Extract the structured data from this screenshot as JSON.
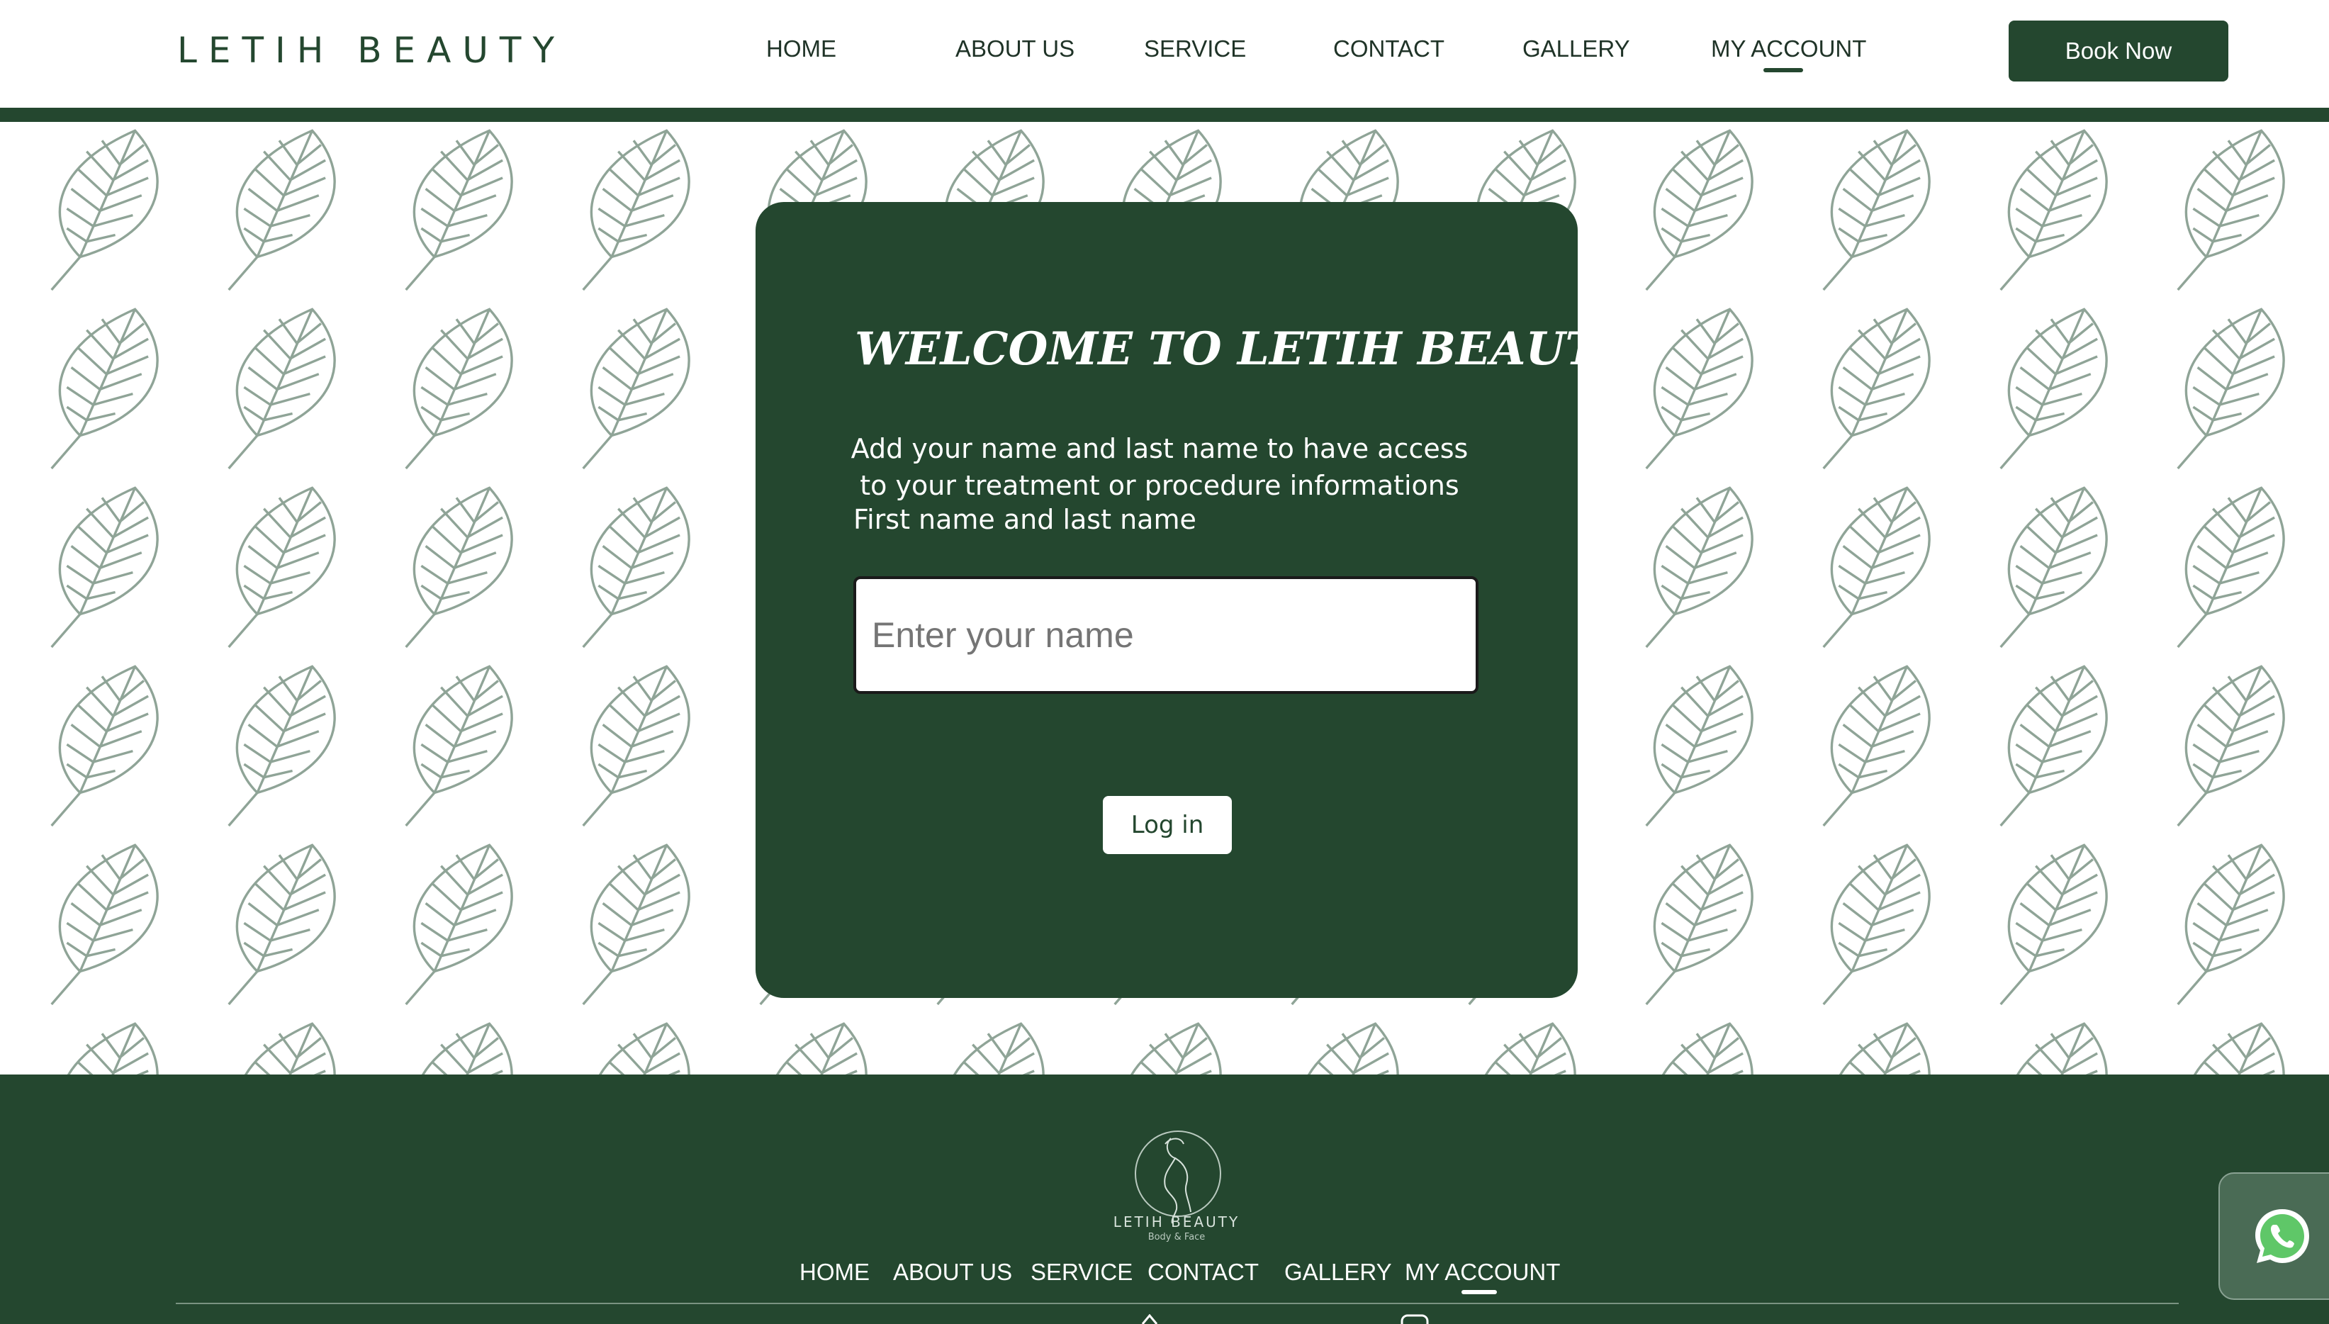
{
  "header": {
    "brand": "LETIH BEAUTY",
    "nav": [
      {
        "label": "HOME",
        "key": "home"
      },
      {
        "label": "ABOUT US",
        "key": "about-us"
      },
      {
        "label": "SERVICE",
        "key": "service"
      },
      {
        "label": "CONTACT",
        "key": "contact"
      },
      {
        "label": "GALLERY",
        "key": "gallery"
      },
      {
        "label": "MY ACCOUNT",
        "key": "my-account",
        "active": true
      }
    ],
    "book_label": "Book Now"
  },
  "login_card": {
    "title": "WELCOME TO LETIH BEAUTY",
    "description": "Add your name and last name to have access to your treatment or procedure informations",
    "field_label": "First name and last name",
    "name_placeholder": "Enter your name",
    "name_value": "",
    "login_label": "Log in"
  },
  "footer": {
    "logo_text": "LETIH BEAUTY",
    "logo_subtext": "Body & Face",
    "nav": [
      {
        "label": "HOME",
        "key": "home"
      },
      {
        "label": "ABOUT US",
        "key": "about-us"
      },
      {
        "label": "SERVICE",
        "key": "service"
      },
      {
        "label": "CONTACT",
        "key": "contact"
      },
      {
        "label": "GALLERY",
        "key": "gallery"
      },
      {
        "label": "MY ACCOUNT",
        "key": "my-account",
        "active": true
      }
    ]
  },
  "icons": {
    "background_pattern": "leaf-icon",
    "floating": "whatsapp-icon",
    "footer_logo": "woman-silhouette-icon"
  },
  "colors": {
    "brand_green": "#24472f",
    "white": "#ffffff",
    "whatsapp_green": "#5fc768"
  }
}
